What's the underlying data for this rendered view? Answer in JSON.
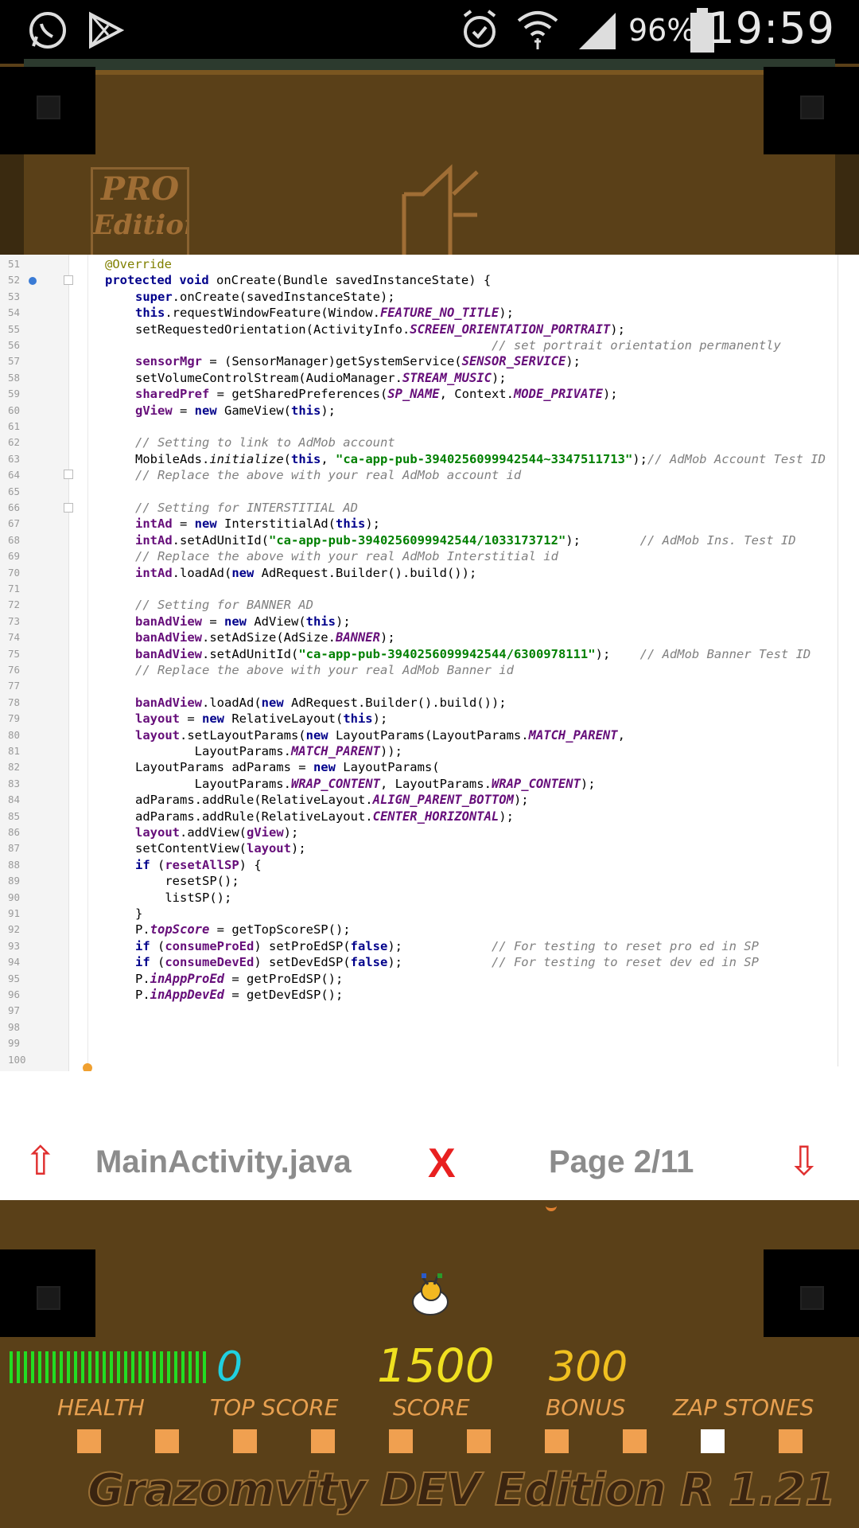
{
  "status_bar": {
    "time": "19:59",
    "battery_percent": "96%",
    "icons": [
      "whatsapp-icon",
      "play-store-icon",
      "alarm-icon",
      "wifi-icon",
      "signal-icon",
      "battery-icon"
    ]
  },
  "game": {
    "badge_line1": "PRO",
    "badge_line2": "Edition"
  },
  "code": {
    "lines": [
      {
        "n": "51",
        "html": "<span class=\"ann\">@Override</span>",
        "indent": 0
      },
      {
        "n": "52",
        "html": "<span class=\"kw\">protected void</span> onCreate(Bundle savedInstanceState) {",
        "indent": 0
      },
      {
        "n": "53",
        "html": "<span class=\"kw\">super</span>.onCreate(savedInstanceState);",
        "indent": 1
      },
      {
        "n": "54",
        "html": "<span class=\"kw\">this</span>.requestWindowFeature(Window.<span class=\"cst\">FEATURE_NO_TITLE</span>);",
        "indent": 1
      },
      {
        "n": "55",
        "html": "setRequestedOrientation(ActivityInfo.<span class=\"cst\">SCREEN_ORIENTATION_PORTRAIT</span>);",
        "indent": 1
      },
      {
        "n": "56",
        "html": "                                                <span class=\"cm\">// set portrait orientation permanently</span>",
        "indent": 1
      },
      {
        "n": "57",
        "html": "<span class=\"fld\">sensorMgr</span> = (SensorManager)getSystemService(<span class=\"cst\">SENSOR_SERVICE</span>);",
        "indent": 1
      },
      {
        "n": "58",
        "html": "setVolumeControlStream(AudioManager.<span class=\"cst\">STREAM_MUSIC</span>);",
        "indent": 1
      },
      {
        "n": "59",
        "html": "<span class=\"fld\">sharedPref</span> = getSharedPreferences(<span class=\"cst\">SP_NAME</span>, Context.<span class=\"cst\">MODE_PRIVATE</span>);",
        "indent": 1
      },
      {
        "n": "60",
        "html": "<span class=\"fld\">gView</span> = <span class=\"kw\">new</span> GameView(<span class=\"kw\">this</span>);",
        "indent": 1
      },
      {
        "n": "61",
        "html": "",
        "indent": 1
      },
      {
        "n": "62",
        "html": "<span class=\"cm\">// Setting to link to AdMob account</span>",
        "indent": 1
      },
      {
        "n": "63",
        "html": "MobileAds.<span class=\"it\">initialize</span>(<span class=\"kw\">this</span>, <span class=\"str\">\"ca-app-pub-3940256099942544~3347511713\"</span>);<span class=\"cm\">// AdMob Account Test ID</span>",
        "indent": 1
      },
      {
        "n": "64",
        "html": "<span class=\"cm\">// Replace the above with your real AdMob account id</span>",
        "indent": 1
      },
      {
        "n": "65",
        "html": "",
        "indent": 1
      },
      {
        "n": "66",
        "html": "<span class=\"cm\">// Setting for INTERSTITIAL AD</span>",
        "indent": 1
      },
      {
        "n": "67",
        "html": "<span class=\"fld\">intAd</span> = <span class=\"kw\">new</span> InterstitialAd(<span class=\"kw\">this</span>);",
        "indent": 1
      },
      {
        "n": "68",
        "html": "<span class=\"fld\">intAd</span>.setAdUnitId(<span class=\"str\">\"ca-app-pub-3940256099942544/1033173712\"</span>);        <span class=\"cm\">// AdMob Ins. Test ID</span>",
        "indent": 1
      },
      {
        "n": "69",
        "html": "<span class=\"cm\">// Replace the above with your real AdMob Interstitial id</span>",
        "indent": 1
      },
      {
        "n": "70",
        "html": "<span class=\"fld\">intAd</span>.loadAd(<span class=\"kw\">new</span> AdRequest.Builder().build());",
        "indent": 1
      },
      {
        "n": "71",
        "html": "",
        "indent": 1
      },
      {
        "n": "72",
        "html": "<span class=\"cm\">// Setting for BANNER AD</span>",
        "indent": 1
      },
      {
        "n": "73",
        "html": "<span class=\"fld\">banAdView</span> = <span class=\"kw\">new</span> AdView(<span class=\"kw\">this</span>);",
        "indent": 1
      },
      {
        "n": "74",
        "html": "<span class=\"fld\">banAdView</span>.setAdSize(AdSize.<span class=\"cst\">BANNER</span>);",
        "indent": 1
      },
      {
        "n": "75",
        "html": "<span class=\"fld\">banAdView</span>.setAdUnitId(<span class=\"str\">\"ca-app-pub-3940256099942544/6300978111\"</span>);    <span class=\"cm\">// AdMob Banner Test ID</span>",
        "indent": 1
      },
      {
        "n": "76",
        "html": "<span class=\"cm\">// Replace the above with your real AdMob Banner id</span>",
        "indent": 1
      },
      {
        "n": "77",
        "html": "",
        "indent": 1
      },
      {
        "n": "78",
        "html": "<span class=\"fld\">banAdView</span>.loadAd(<span class=\"kw\">new</span> AdRequest.Builder().build());",
        "indent": 1
      },
      {
        "n": "79",
        "html": "<span class=\"fld\">layout</span> = <span class=\"kw\">new</span> RelativeLayout(<span class=\"kw\">this</span>);",
        "indent": 1
      },
      {
        "n": "80",
        "html": "<span class=\"fld\">layout</span>.setLayoutParams(<span class=\"kw\">new</span> LayoutParams(LayoutParams.<span class=\"cst\">MATCH_PARENT</span>,",
        "indent": 1
      },
      {
        "n": "81",
        "html": "        LayoutParams.<span class=\"cst\">MATCH_PARENT</span>));",
        "indent": 1
      },
      {
        "n": "82",
        "html": "LayoutParams adParams = <span class=\"kw\">new</span> LayoutParams(",
        "indent": 1
      },
      {
        "n": "83",
        "html": "        LayoutParams.<span class=\"cst\">WRAP_CONTENT</span>, LayoutParams.<span class=\"cst\">WRAP_CONTENT</span>);",
        "indent": 1
      },
      {
        "n": "84",
        "html": "adParams.addRule(RelativeLayout.<span class=\"cst\">ALIGN_PARENT_BOTTOM</span>);",
        "indent": 1
      },
      {
        "n": "85",
        "html": "adParams.addRule(RelativeLayout.<span class=\"cst\">CENTER_HORIZONTAL</span>);",
        "indent": 1
      },
      {
        "n": "86",
        "html": "<span class=\"fld\">layout</span>.addView(<span class=\"fld\">gView</span>);",
        "indent": 1
      },
      {
        "n": "87",
        "html": "setContentView(<span class=\"fld\">layout</span>);",
        "indent": 1
      },
      {
        "n": "88",
        "html": "<span class=\"kw\">if</span> (<span class=\"fld\">resetAllSP</span>) {",
        "indent": 1
      },
      {
        "n": "89",
        "html": "    resetSP();",
        "indent": 1
      },
      {
        "n": "90",
        "html": "    listSP();",
        "indent": 1
      },
      {
        "n": "91",
        "html": "}",
        "indent": 1
      },
      {
        "n": "92",
        "html": "P.<span class=\"fld it\">topScore</span> = getTopScoreSP();",
        "indent": 1
      },
      {
        "n": "93",
        "html": "<span class=\"kw\">if</span> (<span class=\"fld\">consumeProEd</span>) setProEdSP(<span class=\"kw\">false</span>);            <span class=\"cm\">// For testing to reset pro ed in SP</span>",
        "indent": 1
      },
      {
        "n": "94",
        "html": "<span class=\"kw\">if</span> (<span class=\"fld\">consumeDevEd</span>) setDevEdSP(<span class=\"kw\">false</span>);            <span class=\"cm\">// For testing to reset dev ed in SP</span>",
        "indent": 1
      },
      {
        "n": "95",
        "html": "P.<span class=\"fld it\">inAppProEd</span> = getProEdSP();",
        "indent": 1
      },
      {
        "n": "96",
        "html": "P.<span class=\"fld it\">inAppDevEd</span> = getDevEdSP();",
        "indent": 1
      },
      {
        "n": "97",
        "html": "",
        "indent": 1
      },
      {
        "n": "98",
        "html": "",
        "indent": 1
      },
      {
        "n": "99",
        "html": "",
        "indent": 1
      },
      {
        "n": "100",
        "html": "",
        "indent": 1
      }
    ]
  },
  "nav": {
    "file_name": "MainActivity.java",
    "close_label": "X",
    "page_label": "Page 2/11",
    "up_icon": "up-arrow-icon",
    "down_icon": "down-arrow-icon"
  },
  "hud": {
    "health_segments": 28,
    "top_score": "0",
    "score": "1500",
    "bonus": "300",
    "labels": {
      "health": "HEALTH",
      "top_score": "TOP SCORE",
      "score": "SCORE",
      "bonus": "BONUS",
      "zap_stones": "ZAP STONES"
    },
    "stones": [
      0,
      0,
      0,
      0,
      0,
      0,
      0,
      0,
      1,
      0
    ],
    "footer_title": "Grazomvity DEV Edition R 1.21",
    "colors": {
      "top_score": "#20d0e0",
      "score": "#f0e020",
      "bonus": "#f0c020",
      "health": "#22dd22"
    }
  }
}
